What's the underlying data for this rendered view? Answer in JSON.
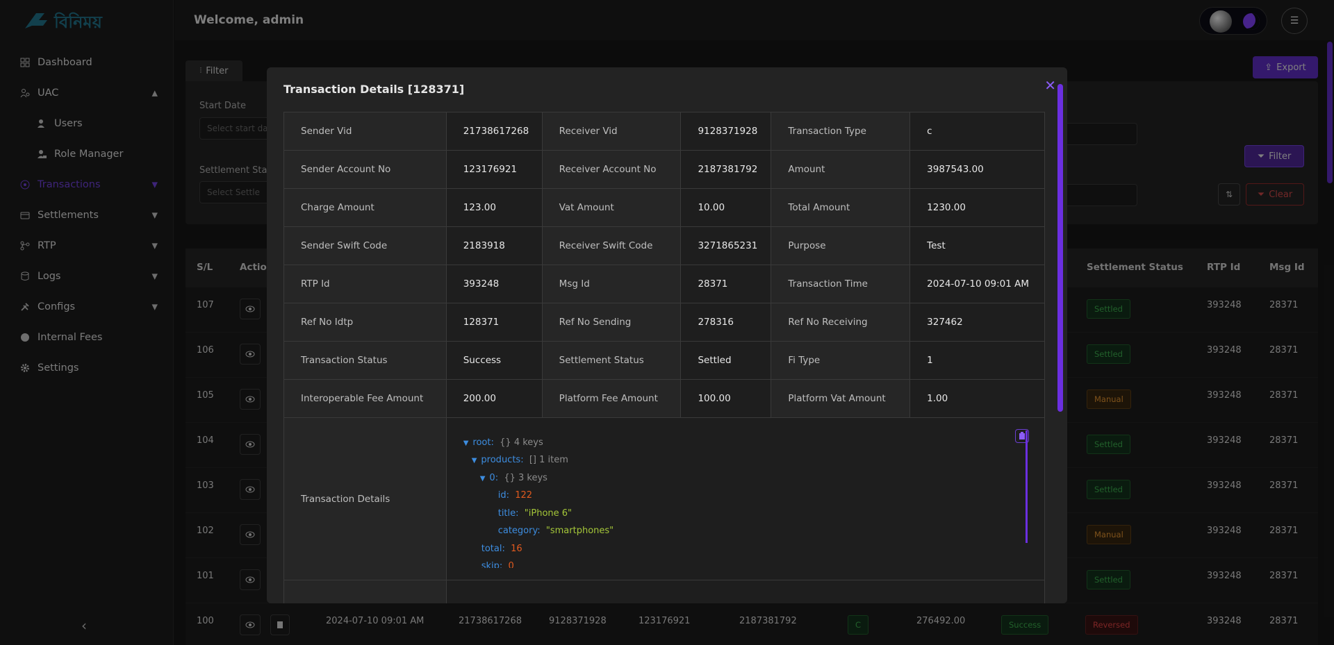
{
  "app": {
    "logo_text": "বিনিময়",
    "welcome": "Welcome,  admin"
  },
  "sidebar": {
    "items": [
      {
        "label": "Dashboard",
        "icon": "grid-icon"
      },
      {
        "label": "UAC",
        "icon": "users-icon",
        "expanded": true
      },
      {
        "label": "Users",
        "icon": "user-icon",
        "sub": true
      },
      {
        "label": "Role Manager",
        "icon": "user-lock-icon",
        "sub": true
      },
      {
        "label": "Transactions",
        "icon": "transfer-icon",
        "active": true
      },
      {
        "label": "Settlements",
        "icon": "wallet-icon"
      },
      {
        "label": "RTP",
        "icon": "branch-icon"
      },
      {
        "label": "Logs",
        "icon": "database-icon"
      },
      {
        "label": "Configs",
        "icon": "tools-icon"
      },
      {
        "label": "Internal Fees",
        "icon": "coin-icon"
      },
      {
        "label": "Settings",
        "icon": "gear-icon"
      }
    ]
  },
  "filters": {
    "tab_label": "Filter",
    "start_date_label": "Start Date",
    "start_date_placeholder": "Select start da",
    "settlement_status_label": "Settlement Sta",
    "settlement_placeholder": "Select Settle",
    "export_label": "Export",
    "filter_label": "Filter",
    "clear_label": "Clear"
  },
  "table": {
    "headers": {
      "sl": "S/L",
      "action": "Actio",
      "settlement_status": "Settlement Status",
      "rtp_id": "RTP Id",
      "msg_id": "Msg Id"
    },
    "rows": [
      {
        "sl": "107",
        "settlement": "Settled",
        "rtp": "393248",
        "msg": "28371"
      },
      {
        "sl": "106",
        "settlement": "Settled",
        "rtp": "393248",
        "msg": "28371"
      },
      {
        "sl": "105",
        "settlement": "Manual",
        "rtp": "393248",
        "msg": "28371"
      },
      {
        "sl": "104",
        "settlement": "Settled",
        "rtp": "393248",
        "msg": "28371"
      },
      {
        "sl": "103",
        "settlement": "Settled",
        "rtp": "393248",
        "msg": "28371"
      },
      {
        "sl": "102",
        "settlement": "Manual",
        "rtp": "393248",
        "msg": "28371"
      },
      {
        "sl": "101",
        "settlement": "Settled",
        "rtp": "393248",
        "msg": "28371"
      }
    ],
    "last_row": {
      "sl": "100",
      "time": "2024-07-10 09:01 AM",
      "sender_vid": "21738617268",
      "receiver_vid": "9128371928",
      "sender_acc": "123176921",
      "receiver_acc": "2187381792",
      "type": "C",
      "amount": "276492.00",
      "status": "Success",
      "settlement": "Reversed",
      "rtp": "393248",
      "msg": "28371"
    }
  },
  "modal": {
    "title": "Transaction Details [128371]",
    "rows": [
      [
        "Sender Vid",
        "21738617268",
        "Receiver Vid",
        "9128371928",
        "Transaction Type",
        "c"
      ],
      [
        "Sender Account No",
        "123176921",
        "Receiver Account No",
        "2187381792",
        "Amount",
        "3987543.00"
      ],
      [
        "Charge Amount",
        "123.00",
        "Vat Amount",
        "10.00",
        "Total Amount",
        "1230.00"
      ],
      [
        "Sender Swift Code",
        "2183918",
        "Receiver Swift Code",
        "3271865231",
        "Purpose",
        "Test"
      ],
      [
        "RTP Id",
        "393248",
        "Msg Id",
        "28371",
        "Transaction Time",
        "2024-07-10 09:01 AM"
      ],
      [
        "Ref No Idtp",
        "128371",
        "Ref No Sending",
        "278316",
        "Ref No Receiving",
        "327462"
      ],
      [
        "Transaction Status",
        "Success",
        "Settlement Status",
        "Settled",
        "Fi Type",
        "1"
      ],
      [
        "Interoperable Fee Amount",
        "200.00",
        "Platform Fee Amount",
        "100.00",
        "Platform Vat Amount",
        "1.00"
      ]
    ],
    "json_label": "Transaction Details",
    "json": {
      "root_key": "root:",
      "root_meta": "{}  4 keys",
      "products_key": "products:",
      "products_meta": "[]  1 item",
      "item_key": "0:",
      "item_meta": "{}  3 keys",
      "id_key": "id:",
      "id_val": "122",
      "title_key": "title:",
      "title_val": "\"iPhone 6\"",
      "category_key": "category:",
      "category_val": "\"smartphones\"",
      "total_key": "total:",
      "total_val": "16",
      "skip_key": "skip:",
      "skip_val": "0"
    }
  },
  "colors": {
    "accent": "#6b3fd1",
    "success": "#3aa54a",
    "warning": "#d98d2f",
    "danger": "#d64040"
  }
}
